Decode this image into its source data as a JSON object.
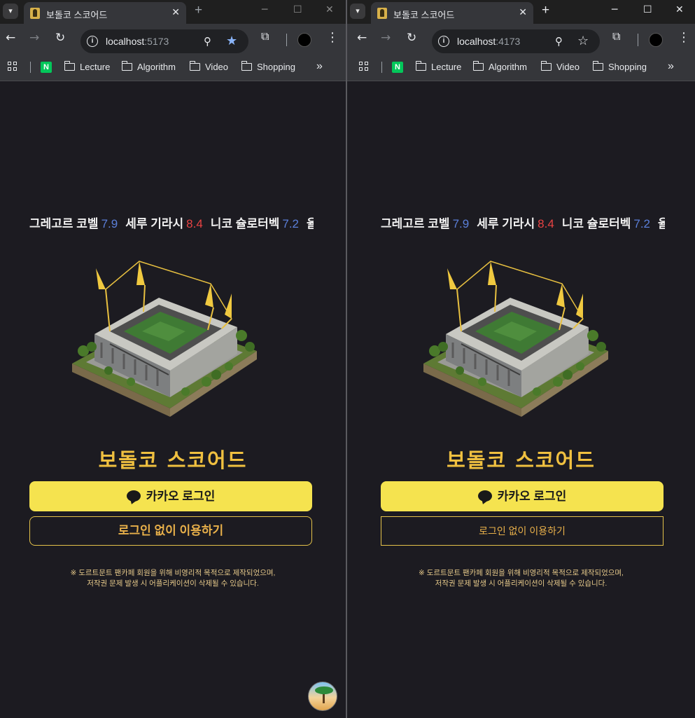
{
  "windows": [
    {
      "id": "left",
      "tab": {
        "title": "보돌코 스코어드",
        "close": "✕",
        "new_tab": "+"
      },
      "address": {
        "host": "localhost",
        "port": ":5173",
        "bookmarked": true
      },
      "bookmarks": [
        "Lecture",
        "Algorithm",
        "Video",
        "Shopping"
      ],
      "bookmarks_more": "»",
      "page": {
        "ticker": [
          {
            "name": "그레고르 코벨",
            "rating": "7.9",
            "color": "#5b7fd9"
          },
          {
            "name": "세루 기라시",
            "rating": "8.4",
            "color": "#e84343"
          },
          {
            "name": "니코 슐로터벡",
            "rating": "7.2",
            "color": "#5b7fd9"
          },
          {
            "name": "율",
            "rating": "",
            "color": "#5b7fd9"
          }
        ],
        "title": "보돌코 스코어드",
        "kakao_button": "카카오 로그인",
        "guest_button": "로그인 없이 이용하기",
        "notice_line1": "※ 도르트문트 팬카페 회원을 위해 비영리적 목적으로 제작되었으며,",
        "notice_line2": "저작권 문제 발생 시 어플리케이션이 삭제될 수 있습니다."
      }
    },
    {
      "id": "right",
      "tab": {
        "title": "보돌코 스코어드",
        "close": "✕",
        "new_tab": "+"
      },
      "address": {
        "host": "localhost",
        "port": ":4173",
        "bookmarked": false
      },
      "bookmarks": [
        "Lecture",
        "Algorithm",
        "Video",
        "Shopping"
      ],
      "bookmarks_more": "»",
      "page": {
        "ticker": [
          {
            "name": "그레고르 코벨",
            "rating": "7.9",
            "color": "#5b7fd9"
          },
          {
            "name": "세루 기라시",
            "rating": "8.4",
            "color": "#e84343"
          },
          {
            "name": "니코 슐로터벡",
            "rating": "7.2",
            "color": "#5b7fd9"
          },
          {
            "name": "율",
            "rating": "",
            "color": "#5b7fd9"
          }
        ],
        "title": "보돌코 스코어드",
        "kakao_button": "카카오 로그인",
        "guest_button": "로그인 없이 이용하기",
        "notice_line1": "※ 도르트문트 팬카페 회원을 위해 비영리적 목적으로 제작되었으며,",
        "notice_line2": "저작권 문제 발생 시 어플리케이션이 삭제될 수 있습니다."
      }
    }
  ],
  "icons": {
    "tab_menu": "chevron-down-icon",
    "back": "back-arrow-icon",
    "forward": "forward-arrow-icon",
    "reload": "reload-icon",
    "site_info": "info-icon",
    "zoom": "zoom-icon",
    "bookmark": "star-icon",
    "extensions": "puzzle-icon",
    "profile": "profile-avatar-icon",
    "menu": "kebab-menu-icon",
    "apps": "apps-grid-icon",
    "naver": "naver-icon",
    "folder": "folder-icon",
    "kakao": "speech-bubble-icon",
    "floating": "beach-avatar-icon",
    "stadium": "stadium-illustration"
  },
  "colors": {
    "page_background": "#1c1b21",
    "brand_gold": "#f0c040",
    "kakao_yellow": "#f5e34f",
    "rating_blue": "#5b7fd9",
    "rating_red": "#e84343",
    "bookmark_star_active": "#8ab4f8"
  }
}
